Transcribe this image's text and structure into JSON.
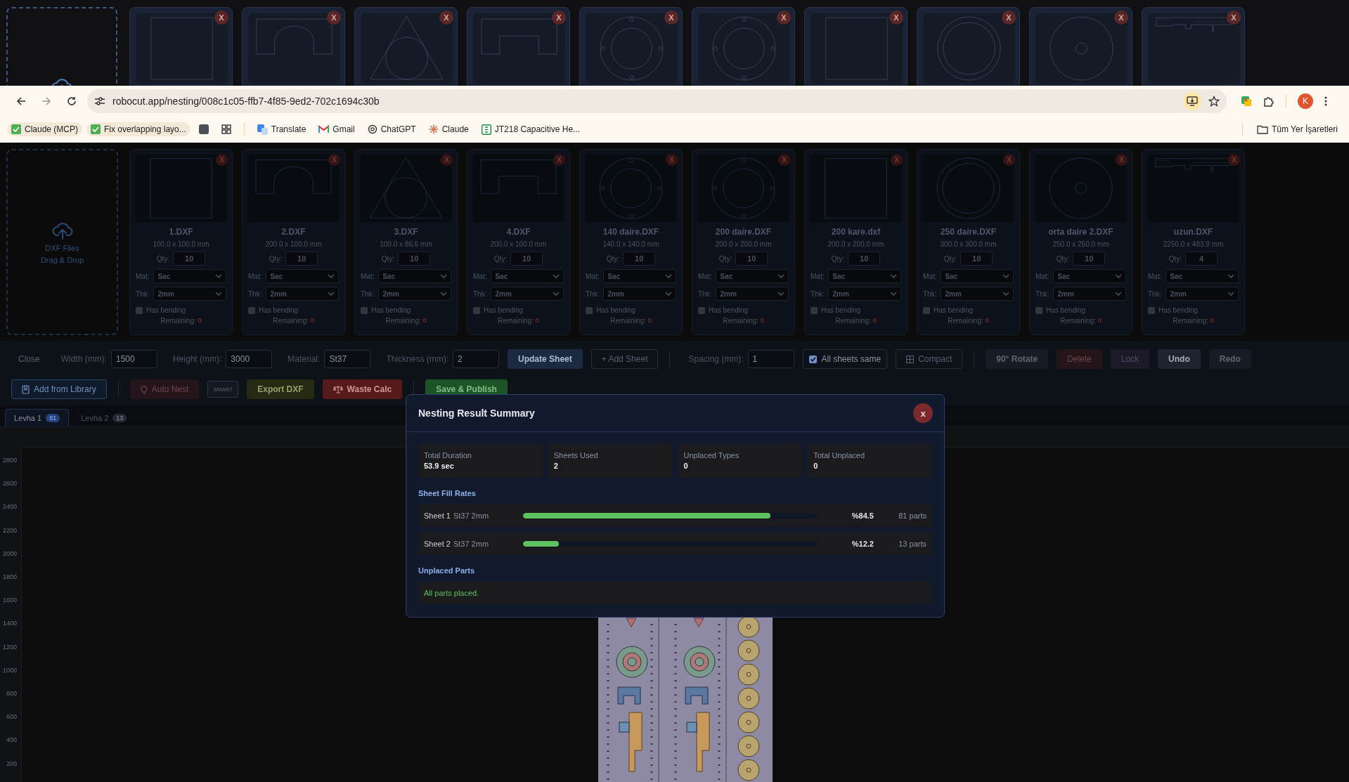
{
  "top_strip": {
    "cards": [
      {
        "kind": "square",
        "close": "X"
      },
      {
        "kind": "arc-notch",
        "close": "X"
      },
      {
        "kind": "triangle-circle",
        "close": "X"
      },
      {
        "kind": "rect-notch",
        "close": "X"
      },
      {
        "kind": "flange",
        "close": "X"
      },
      {
        "kind": "flange",
        "close": "X"
      },
      {
        "kind": "square",
        "close": "X"
      },
      {
        "kind": "double-ring",
        "close": "X"
      },
      {
        "kind": "disc-hole",
        "close": "X"
      },
      {
        "kind": "strip",
        "close": "X"
      }
    ]
  },
  "browser": {
    "url": "robocut.app/nesting/008c1c05-ffb7-4f85-9ed2-702c1694c30b",
    "profile": "K",
    "all_bookmarks": "Tüm Yer İşaretleri",
    "bookmarks": [
      {
        "kind": "check",
        "label": "Claude (MCP)",
        "chip": true
      },
      {
        "kind": "check",
        "label": "Fix overlapping layo...",
        "chip": true
      },
      {
        "kind": "square",
        "chip": false
      },
      {
        "kind": "apps",
        "chip": false
      },
      {
        "kind": "translate",
        "label": "Translate",
        "chip": false
      },
      {
        "kind": "mail",
        "label": "Gmail",
        "chip": false
      },
      {
        "kind": "knot",
        "label": "ChatGPT",
        "chip": false
      },
      {
        "kind": "burst",
        "label": "Claude",
        "chip": false
      },
      {
        "kind": "sheet",
        "label": "JT218 Capacitive He...",
        "chip": false
      }
    ]
  },
  "upload": {
    "lines": [
      "DXF Files",
      "Drag & Drop"
    ]
  },
  "parts": [
    {
      "name": "1.DXF",
      "size": "100.0 x 100.0 mm",
      "qty_label": "Qty:",
      "qty": "10",
      "mat_label": "Mat:",
      "material": "Sac",
      "thk_label": "Thk:",
      "thickness": "2mm",
      "bending_label": "Has bending",
      "bending": false,
      "remaining_label": "Remaining:",
      "remaining": "0",
      "kind": "square",
      "close": "X"
    },
    {
      "name": "2.DXF",
      "size": "200.0 x 100.0 mm",
      "qty_label": "Qty:",
      "qty": "10",
      "mat_label": "Mat:",
      "material": "Sac",
      "thk_label": "Thk:",
      "thickness": "2mm",
      "bending_label": "Has bending",
      "bending": false,
      "remaining_label": "Remaining:",
      "remaining": "0",
      "kind": "arc-notch",
      "close": "X"
    },
    {
      "name": "3.DXF",
      "size": "100.0 x 86.6 mm",
      "qty_label": "Qty:",
      "qty": "10",
      "mat_label": "Mat:",
      "material": "Sac",
      "thk_label": "Thk:",
      "thickness": "2mm",
      "bending_label": "Has bending",
      "bending": false,
      "remaining_label": "Remaining:",
      "remaining": "0",
      "kind": "triangle-circle",
      "close": "X"
    },
    {
      "name": "4.DXF",
      "size": "200.0 x 100.0 mm",
      "qty_label": "Qty:",
      "qty": "10",
      "mat_label": "Mat:",
      "material": "Sac",
      "thk_label": "Thk:",
      "thickness": "2mm",
      "bending_label": "Has bending",
      "bending": false,
      "remaining_label": "Remaining:",
      "remaining": "0",
      "kind": "rect-notch",
      "close": "X"
    },
    {
      "name": "140 daire.DXF",
      "size": "140.0 x 140.0 mm",
      "qty_label": "Qty:",
      "qty": "10",
      "mat_label": "Mat:",
      "material": "Sac",
      "thk_label": "Thk:",
      "thickness": "2mm",
      "bending_label": "Has bending",
      "bending": false,
      "remaining_label": "Remaining:",
      "remaining": "0",
      "kind": "flange",
      "close": "X"
    },
    {
      "name": "200 daire.DXF",
      "size": "200.0 x 200.0 mm",
      "qty_label": "Qty:",
      "qty": "10",
      "mat_label": "Mat:",
      "material": "Sac",
      "thk_label": "Thk:",
      "thickness": "2mm",
      "bending_label": "Has bending",
      "bending": false,
      "remaining_label": "Remaining:",
      "remaining": "0",
      "kind": "flange",
      "close": "X"
    },
    {
      "name": "200 kare.dxf",
      "size": "200.0 x 200.0 mm",
      "qty_label": "Qty:",
      "qty": "10",
      "mat_label": "Mat:",
      "material": "Sac",
      "thk_label": "Thk:",
      "thickness": "2mm",
      "bending_label": "Has bending",
      "bending": false,
      "remaining_label": "Remaining:",
      "remaining": "0",
      "kind": "square",
      "close": "X"
    },
    {
      "name": "250 daire.DXF",
      "size": "300.0 x 300.0 mm",
      "qty_label": "Qty:",
      "qty": "10",
      "mat_label": "Mat:",
      "material": "Sac",
      "thk_label": "Thk:",
      "thickness": "2mm",
      "bending_label": "Has bending",
      "bending": false,
      "remaining_label": "Remaining:",
      "remaining": "0",
      "kind": "double-ring",
      "close": "X"
    },
    {
      "name": "orta daire 2.DXF",
      "size": "250.0 x 250.0 mm",
      "qty_label": "Qty:",
      "qty": "10",
      "mat_label": "Mat:",
      "material": "Sac",
      "thk_label": "Thk:",
      "thickness": "2mm",
      "bending_label": "Has bending",
      "bending": false,
      "remaining_label": "Remaining:",
      "remaining": "0",
      "kind": "disc-hole",
      "close": "X"
    },
    {
      "name": "uzun.DXF",
      "size": "2250.0 x 483.9 mm",
      "qty_label": "Qty:",
      "qty": "4",
      "mat_label": "Mat:",
      "material": "Sac",
      "thk_label": "Thk:",
      "thickness": "2mm",
      "bending_label": "Has bending",
      "bending": false,
      "remaining_label": "Remaining:",
      "remaining": "0",
      "kind": "strip",
      "close": "X"
    }
  ],
  "toolbar_row1": [
    {
      "kind": "link",
      "label": "Close"
    },
    {
      "kind": "field",
      "label": "Width (mm):",
      "value": "1500"
    },
    {
      "kind": "field",
      "label": "Height (mm):",
      "value": "3000"
    },
    {
      "kind": "field",
      "label": "Material:",
      "value": "St37"
    },
    {
      "kind": "field",
      "label": "Thickness (mm):",
      "value": "2"
    },
    {
      "kind": "primary",
      "label": "Update Sheet",
      "disabled": false
    },
    {
      "kind": "outline",
      "label": "+ Add Sheet",
      "disabled": false
    },
    {
      "kind": "divider"
    },
    {
      "kind": "field",
      "label": "Spacing (mm):",
      "value": "1"
    },
    {
      "kind": "checkbox",
      "label": "All sheets same",
      "checked": true
    },
    {
      "kind": "compact",
      "label": "Compact",
      "disabled": false
    },
    {
      "kind": "divider"
    },
    {
      "kind": "slate",
      "label": "90° Rotate",
      "disabled": true
    },
    {
      "kind": "red",
      "label": "Delete",
      "disabled": true
    },
    {
      "kind": "purple",
      "label": "Lock",
      "disabled": true
    },
    {
      "kind": "slate",
      "label": "Undo",
      "disabled": false
    },
    {
      "kind": "slate",
      "label": "Redo",
      "disabled": true
    }
  ],
  "toolbar_row2": [
    {
      "kind": "library",
      "label": "Add from Library",
      "disabled": false
    },
    {
      "kind": "divider"
    },
    {
      "kind": "autonest",
      "label": "Auto Nest",
      "disabled": true
    },
    {
      "kind": "tag",
      "label": "SMART",
      "disabled": false
    },
    {
      "kind": "olive",
      "label": "Export DXF",
      "disabled": false
    },
    {
      "kind": "waste",
      "label": "Waste Calc",
      "disabled": false
    },
    {
      "kind": "divider"
    },
    {
      "kind": "green",
      "label": "Save & Publish",
      "disabled": false
    }
  ],
  "tabs": [
    {
      "label": "Levha 1",
      "count": "81",
      "selected": true
    },
    {
      "label": "Levha 2",
      "count": "13",
      "selected": false
    }
  ],
  "canvas": {
    "y_labels": [
      "2800",
      "2600",
      "2400",
      "2200",
      "2000",
      "1800",
      "1600",
      "1400",
      "1200",
      "1000",
      "800",
      "600",
      "400",
      "200"
    ]
  },
  "modal": {
    "title": "Nesting Result Summary",
    "close": "x",
    "stats": [
      {
        "label": "Total Duration",
        "value": "53.9 sec"
      },
      {
        "label": "Sheets Used",
        "value": "2"
      },
      {
        "label": "Unplaced Types",
        "value": "0"
      },
      {
        "label": "Total Unplaced",
        "value": "0"
      }
    ],
    "fill_title": "Sheet Fill Rates",
    "sheets": [
      {
        "name": "Sheet 1",
        "meta": "St37 2mm",
        "level": 0.845,
        "percent": "%84.5",
        "parts": "81 parts"
      },
      {
        "name": "Sheet 2",
        "meta": "St37 2mm",
        "level": 0.122,
        "percent": "%12.2",
        "parts": "13 parts"
      }
    ],
    "unplaced_title": "Unplaced Parts",
    "unplaced_message": "All parts placed."
  }
}
